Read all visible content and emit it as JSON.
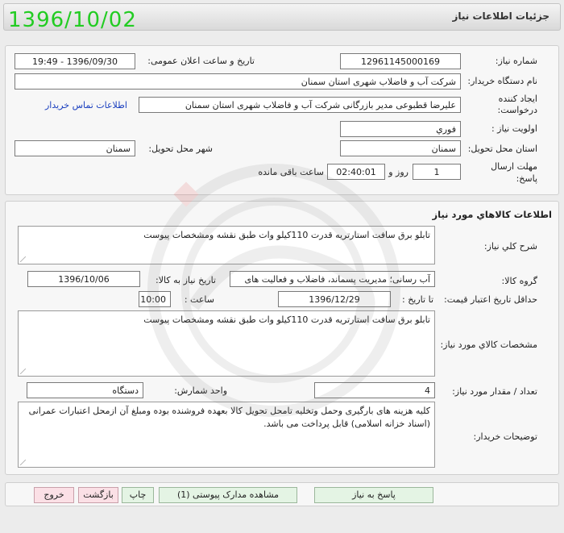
{
  "header": {
    "title": "جزئیات اطلاعات نیاز",
    "date_stamp": "1396/10/02"
  },
  "need_info": {
    "need_number_label": "شماره نیاز:",
    "need_number": "12961145000169",
    "announce_label": "تاریخ و ساعت اعلان عمومی:",
    "announce_value": "1396/09/30 - 19:49",
    "buyer_org_label": "نام دستگاه خریدار:",
    "buyer_org": "شرکت آب و فاضلاب شهری استان سمنان",
    "requester_label_line1": "ایجاد کننده",
    "requester_label_line2": "درخواست:",
    "requester": "علیرضا قطبوعی مدیر بازرگانی شرکت آب و فاضلاب شهری استان سمنان",
    "contact_link": "اطلاعات تماس خریدار",
    "priority_label": "اولویت نیاز :",
    "priority": "فوري",
    "province_label": "استان محل تحویل:",
    "province": "سمنان",
    "city_label": "شهر محل تحویل:",
    "city": "سمنان",
    "deadline_label_line1": "مهلت ارسال",
    "deadline_label_line2": "پاسخ:",
    "deadline_days": "1",
    "days_word": "روز و",
    "deadline_time": "02:40:01",
    "remaining_word": "ساعت باقی مانده"
  },
  "goods": {
    "section_title": "اطلاعات کالاهاي مورد نياز",
    "general_desc_label": "شرح کلي نياز:",
    "general_desc": "تابلو برق سافت استارتریه قدرت 110کیلو وات طبق نقشه ومشخصات پیوست",
    "group_label": "گروه کالا:",
    "group_value": "آب رسانی؛ مدیریت پسماند، فاضلاب و فعالیت های",
    "need_date_label": "تاریخ نیاز به کالا:",
    "need_date": "1396/10/06",
    "min_validity_label": "حداقل تاریخ اعتبار قیمت:",
    "until_date_label": "تا تاریخ :",
    "until_date": "1396/12/29",
    "time_label": "ساعت :",
    "time_value": "10:00",
    "spec_label": "مشخصات کالاي مورد نياز:",
    "spec": "تابلو برق سافت استارتریه قدرت 110کیلو وات طبق نقشه ومشخصات پیوست",
    "qty_label": "تعداد / مقدار مورد نیاز:",
    "qty": "4",
    "unit_label": "واحد شمارش:",
    "unit": "دستگاه",
    "buyer_notes_label": "توضیحات خریدار:",
    "buyer_notes": "کلیه هزینه های بارگیری وحمل وتخلیه تامحل تحویل کالا بعهده فروشنده بوده ومبلغ آن ازمحل اعتبارات عمرانی (اسناد خزانه اسلامی) قابل پرداخت می باشد."
  },
  "buttons": {
    "respond": "پاسخ به نیاز",
    "view_docs": "مشاهده مدارک پیوستی (1)",
    "print": "چاپ",
    "back": "بازگشت",
    "exit": "خروج"
  },
  "colors": {
    "date_stamp": "#22cc22",
    "link": "#1a3fbf",
    "button_green": "#e4f4e4",
    "button_red": "#fbe0e6"
  }
}
